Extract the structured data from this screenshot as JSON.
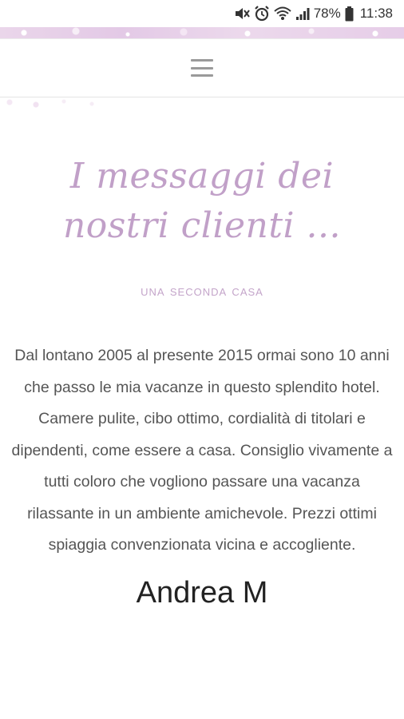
{
  "status_bar": {
    "battery_percent": "78%",
    "time": "11:38",
    "icons": [
      "mute-icon",
      "alarm-icon",
      "wifi-icon",
      "signal-icon",
      "battery-icon"
    ]
  },
  "nav": {
    "menu_icon": "hamburger-menu-icon"
  },
  "colors": {
    "title": "#c1a0c8",
    "subtitle": "#c4a5ca",
    "body_text": "#555555",
    "author": "#222222",
    "floral_band": "#e3c9e6"
  },
  "main": {
    "title": "I messaggi dei nostri clienti ...",
    "subtitle": "una seconda casa",
    "testimonial": "Dal lontano 2005 al presente 2015 ormai sono 10 anni che passo le mia vacanze in questo splendito hotel. Camere pulite, cibo ottimo, cordialità di titolari e dipendenti, come essere a casa. Consiglio vivamente a tutti coloro che vogliono passare una vacanza rilassante in un ambiente amichevole. Prezzi ottimi spiaggia convenzionata vicina e accogliente.",
    "author": "Andrea M"
  }
}
